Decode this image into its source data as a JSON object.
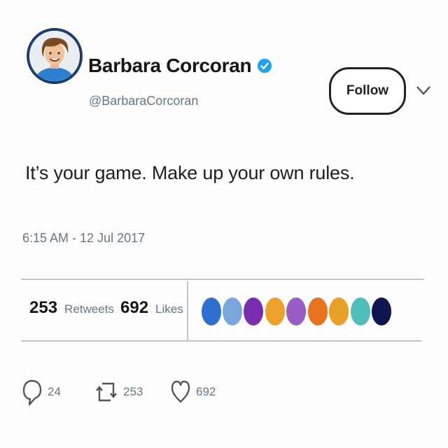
{
  "user": {
    "display_name": "Barbara Corcoran",
    "handle": "@BarbaraCorcoran",
    "verified_icon": "verified-badge-icon",
    "verified_color": "#1da1f2"
  },
  "follow_button": {
    "label": "Follow"
  },
  "menu_icon": "chevron-down-icon",
  "tweet": {
    "text": "It’s your game. Make up your own rules.",
    "timestamp": "6:15 AM - 12 Jul 2017"
  },
  "stats": {
    "retweets": {
      "count": "253",
      "label": "Retweets"
    },
    "likes": {
      "count": "692",
      "label": "Likes"
    }
  },
  "likers": [
    {
      "color": "#2f6fd0"
    },
    {
      "color": "#7aa7de"
    },
    {
      "color": "#7b2db0"
    },
    {
      "color": "#eea12a"
    },
    {
      "color": "#9a5cc4"
    },
    {
      "color": "#e8731f"
    },
    {
      "color": "#e9a027"
    },
    {
      "color": "#4fbdb8"
    },
    {
      "color": "#0f1550"
    }
  ],
  "actions": {
    "reply": {
      "icon": "reply-icon",
      "count": "24"
    },
    "retweet": {
      "icon": "retweet-icon",
      "count": "253"
    },
    "like": {
      "icon": "heart-icon",
      "count": "692"
    }
  }
}
